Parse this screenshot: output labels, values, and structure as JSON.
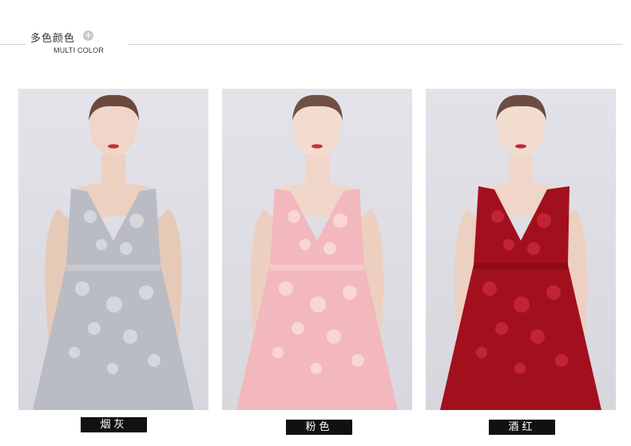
{
  "header": {
    "title_cn": "多色颜色",
    "title_en": "MULTI COLOR",
    "plus_icon": "+"
  },
  "products": [
    {
      "label": "烟灰",
      "dress_color": "#b9bcc4",
      "lace_color": "#d9dbe0"
    },
    {
      "label": "粉色",
      "dress_color": "#f2b8bd",
      "lace_color": "#fbd9d8"
    },
    {
      "label": "酒红",
      "dress_color": "#a3101d",
      "lace_color": "#c8283a"
    }
  ]
}
